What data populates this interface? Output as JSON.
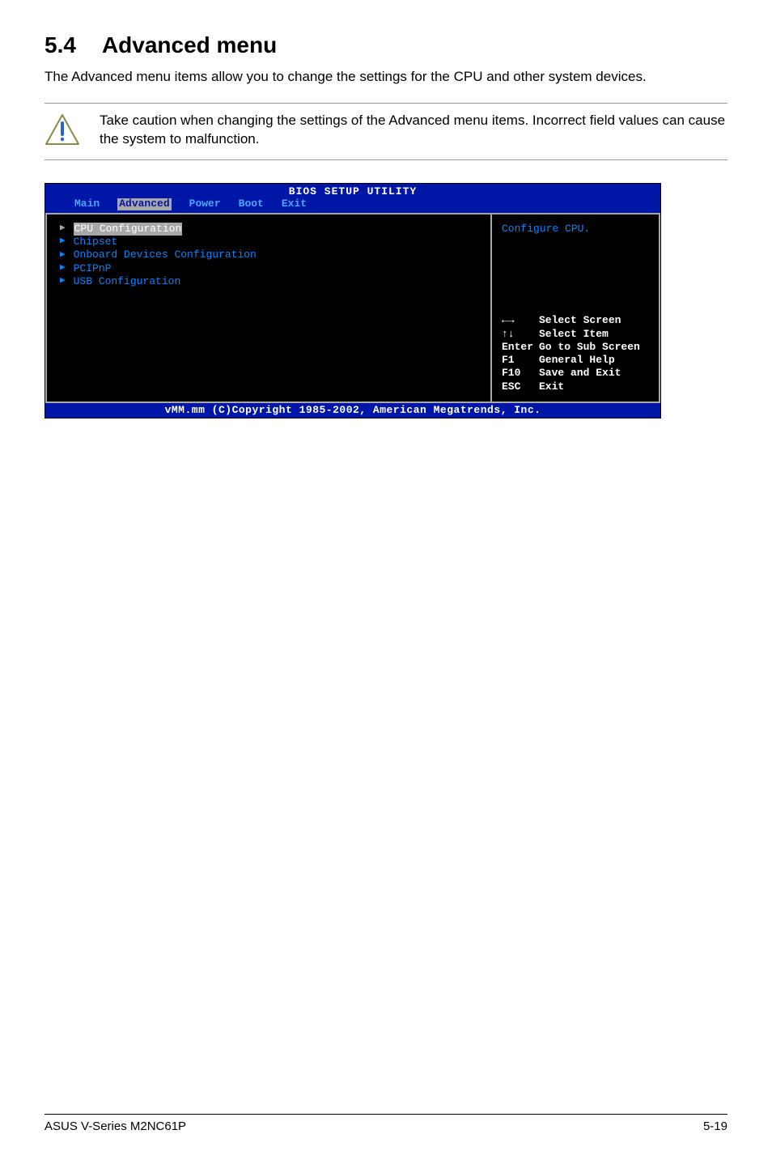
{
  "heading": {
    "number": "5.4",
    "title": "Advanced menu"
  },
  "intro": "The Advanced menu items allow you to change the settings for the CPU and other system devices.",
  "caution": "Take caution when changing the settings of the Advanced menu items. Incorrect field values can cause the system to malfunction.",
  "bios": {
    "title": "BIOS SETUP UTILITY",
    "tabs": [
      "Main",
      "Advanced",
      "Power",
      "Boot",
      "Exit"
    ],
    "active_tab": "Advanced",
    "menu_items": [
      "CPU Configuration",
      "Chipset",
      "Onboard Devices Configuration",
      "PCIPnP",
      "USB Configuration"
    ],
    "selected_item": "CPU Configuration",
    "help_text": "Configure CPU.",
    "keys": [
      {
        "k": "←→",
        "d": "Select Screen"
      },
      {
        "k": "↑↓",
        "d": "Select Item"
      },
      {
        "k": "Enter",
        "d": "Go to Sub Screen"
      },
      {
        "k": "F1",
        "d": "General Help"
      },
      {
        "k": "F10",
        "d": "Save and Exit"
      },
      {
        "k": "ESC",
        "d": "Exit"
      }
    ],
    "footer": "vMM.mm (C)Copyright 1985-2002, American Megatrends, Inc."
  },
  "page_footer": {
    "left": "ASUS V-Series M2NC61P",
    "right": "5-19"
  }
}
